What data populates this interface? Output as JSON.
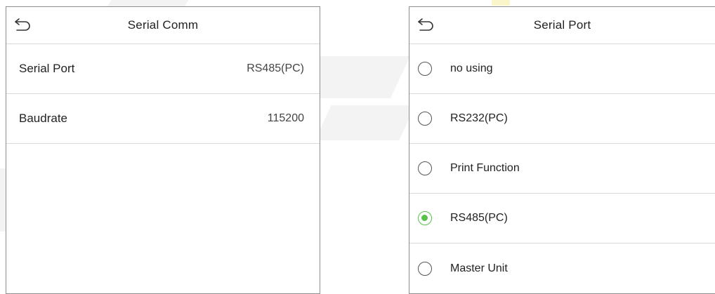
{
  "left_panel": {
    "title": "Serial Comm",
    "rows": [
      {
        "label": "Serial Port",
        "value": "RS485(PC)"
      },
      {
        "label": "Baudrate",
        "value": "115200"
      }
    ]
  },
  "right_panel": {
    "title": "Serial Port",
    "options": [
      {
        "label": "no using",
        "selected": false
      },
      {
        "label": "RS232(PC)",
        "selected": false
      },
      {
        "label": "Print Function",
        "selected": false
      },
      {
        "label": "RS485(PC)",
        "selected": true
      },
      {
        "label": "Master Unit",
        "selected": false
      }
    ]
  },
  "colors": {
    "accent": "#57c14a",
    "divider": "#d9d9d9",
    "border": "#8d8d8d"
  },
  "icons": {
    "back": "back-arrow-icon",
    "radio": "radio-icon"
  }
}
